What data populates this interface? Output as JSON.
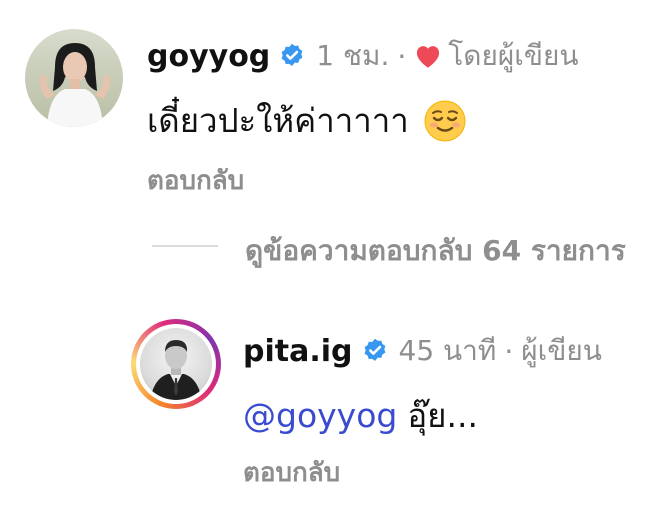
{
  "comment": {
    "username": "goyyog",
    "time": "1 ชม.",
    "separator": "·",
    "liked_by_author_label": "โดยผู้เขียน",
    "text": "เดี๋ยวปะให้ค่าาาาา",
    "emoji": "relieved-face-emoji",
    "reply_label": "ตอบกลับ"
  },
  "view_replies": {
    "label": "ดูข้อความตอบกลับ 64 รายการ"
  },
  "reply": {
    "username": "pita.ig",
    "time": "45 นาที",
    "separator": "·",
    "author_label": "ผู้เขียน",
    "mention": "@goyyog",
    "text": "อุ๊ย...",
    "reply_label": "ตอบกลับ"
  },
  "colors": {
    "verified": "#3897f0",
    "heart": "#ed4956",
    "meta": "#8e8e8e",
    "mention": "#3a4bd0"
  }
}
